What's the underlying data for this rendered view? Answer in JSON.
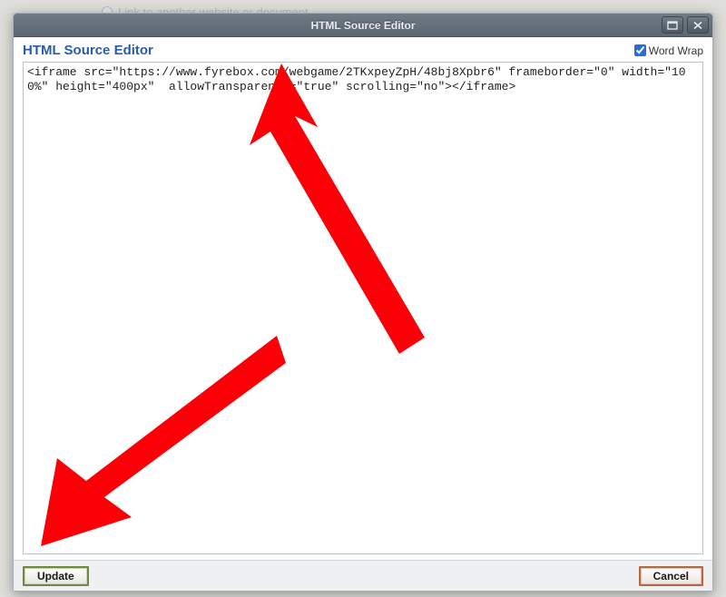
{
  "background": {
    "hint_text": "Link to another website or document"
  },
  "dialog": {
    "window_title": "HTML Source Editor",
    "header_title": "HTML Source Editor",
    "wordwrap_label": "Word Wrap",
    "wordwrap_checked": true,
    "source_code": "<iframe src=\"https://www.fyrebox.com/webgame/2TKxpeyZpH/48bj8Xpbr6\" frameborder=\"0\" width=\"100%\" height=\"400px\"  allowTransparency=\"true\" scrolling=\"no\"></iframe>",
    "buttons": {
      "update": "Update",
      "cancel": "Cancel"
    }
  }
}
